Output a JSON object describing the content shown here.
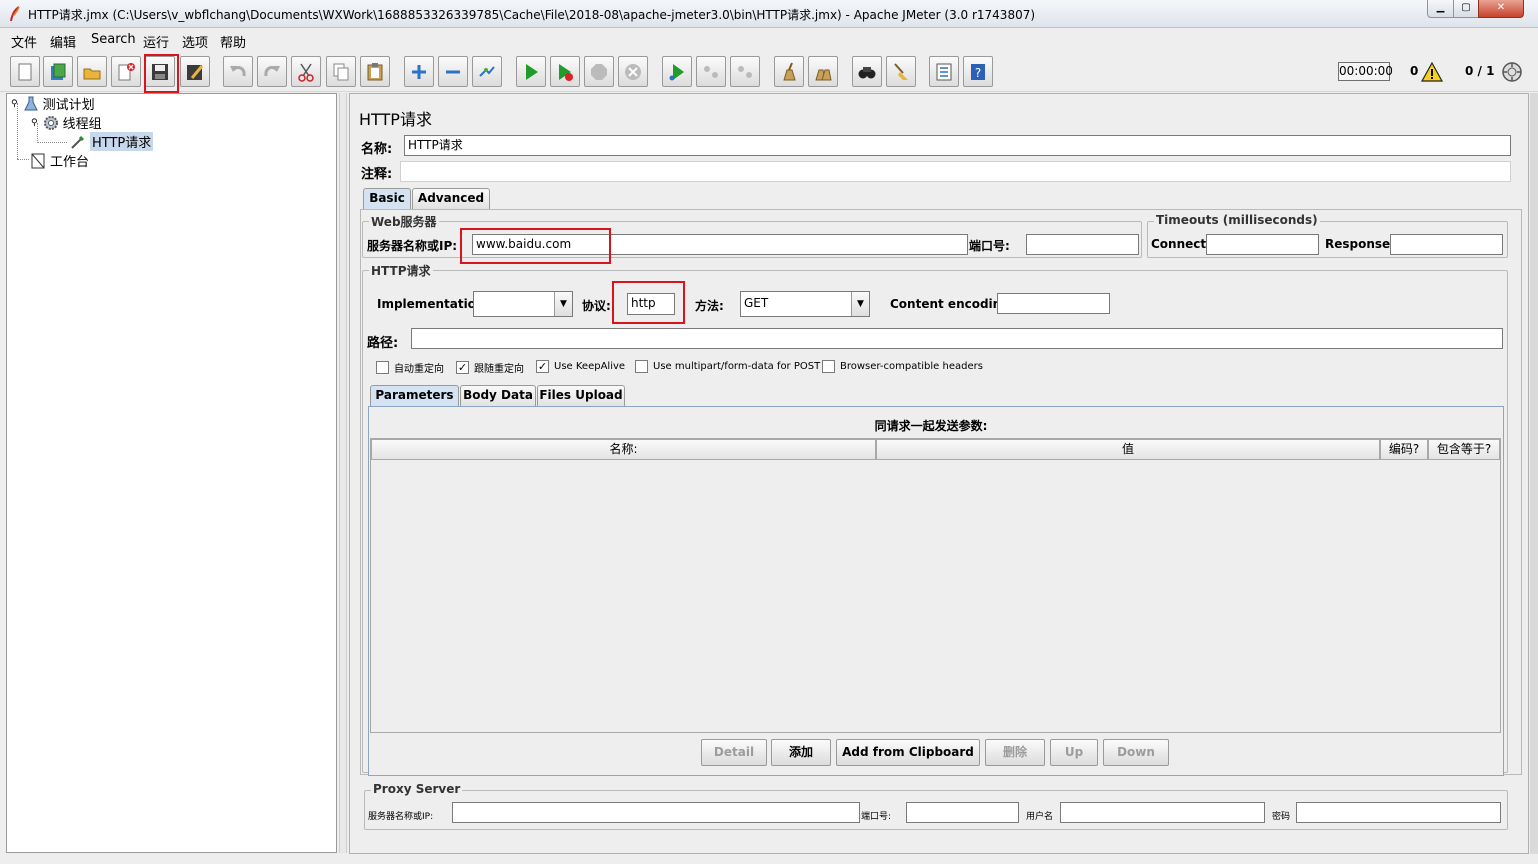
{
  "window": {
    "title": "HTTP请求.jmx (C:\\Users\\v_wbflchang\\Documents\\WXWork\\1688853326339785\\Cache\\File\\2018-08\\apache-jmeter3.0\\bin\\HTTP请求.jmx) - Apache JMeter (3.0 r1743807)",
    "min_glyph": "▁",
    "max_glyph": "▢",
    "close_glyph": "✕"
  },
  "menu": [
    "文件",
    "编辑",
    "Search",
    "运行",
    "选项",
    "帮助"
  ],
  "toolbar": {
    "icons": [
      "new-icon",
      "templates-icon",
      "open-icon",
      "close-icon",
      "save-icon",
      "save-as-icon",
      "undo-icon",
      "redo-icon",
      "cut-icon",
      "copy-icon",
      "paste-icon",
      "expand-icon",
      "collapse-icon",
      "toggle-icon",
      "start-icon",
      "start-no-pauses-icon",
      "stop-icon",
      "shutdown-icon",
      "remote-start-icon",
      "remote-stop-icon",
      "remote-shutdown-icon",
      "clear-icon",
      "clear-all-icon",
      "search-icon",
      "reset-search-icon",
      "function-helper-icon",
      "help-icon"
    ],
    "timer": "00:00:00",
    "error_count": "0",
    "threads": "0 / 1"
  },
  "tree": {
    "test_plan": "测试计划",
    "thread_group": "线程组",
    "http_request": "HTTP请求",
    "workbench": "工作台"
  },
  "panel": {
    "heading": "HTTP请求",
    "name_label": "名称:",
    "name_value": "HTTP请求",
    "comment_label": "注释:",
    "comment_value": "",
    "tabs": [
      "Basic",
      "Advanced"
    ],
    "web_server": {
      "legend": "Web服务器",
      "server_label": "服务器名称或IP:",
      "server_value": "www.baidu.com",
      "port_label": "端口号:",
      "port_value": ""
    },
    "timeouts": {
      "legend": "Timeouts (milliseconds)",
      "connect_label": "Connect:",
      "connect_value": "",
      "response_label": "Response:",
      "response_value": ""
    },
    "http_request": {
      "legend": "HTTP请求",
      "implementation_label": "Implementation:",
      "implementation_value": "",
      "protocol_label": "协议:",
      "protocol_value": "http",
      "method_label": "方法:",
      "method_value": "GET",
      "encoding_label": "Content encoding:",
      "encoding_value": "",
      "path_label": "路径:",
      "path_value": ""
    },
    "checkboxes": [
      {
        "label": "自动重定向",
        "checked": false
      },
      {
        "label": "跟随重定向",
        "checked": true
      },
      {
        "label": "Use KeepAlive",
        "checked": true
      },
      {
        "label": "Use multipart/form-data for POST",
        "checked": false
      },
      {
        "label": "Browser-compatible headers",
        "checked": false
      }
    ],
    "check_glyph": "✓",
    "sub_tabs": [
      "Parameters",
      "Body Data",
      "Files Upload"
    ],
    "params_title": "同请求一起发送参数:",
    "columns": [
      "名称:",
      "值",
      "编码?",
      "包含等于?"
    ],
    "buttons": {
      "detail": "Detail",
      "add": "添加",
      "clipboard": "Add from Clipboard",
      "delete": "删除",
      "up": "Up",
      "down": "Down"
    },
    "proxy": {
      "legend": "Proxy Server",
      "server_label": "服务器名称或IP:",
      "port_label": "端口号:",
      "user_label": "用户名",
      "password_label": "密码"
    }
  },
  "colors": {
    "highlight": "#d9141b",
    "selection": "#c8d8ec",
    "active_tab": "#d4e2f2"
  }
}
